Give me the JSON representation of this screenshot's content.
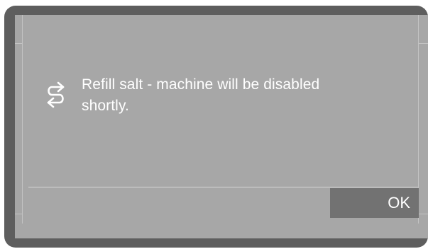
{
  "dialog": {
    "message": "Refill salt - machine will be disabled shortly.",
    "icon": "salt-refill-icon",
    "ok_label": "OK"
  },
  "colors": {
    "bezel": "#5e5e5e",
    "screen": "#a7a7a7",
    "button": "#727272",
    "text": "#ffffff"
  }
}
